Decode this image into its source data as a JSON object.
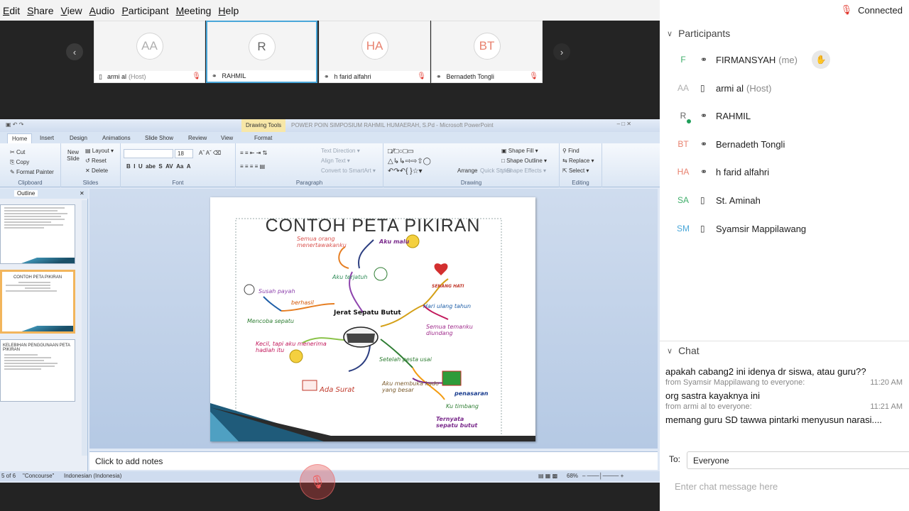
{
  "menu": [
    "Edit",
    "Share",
    "View",
    "Audio",
    "Participant",
    "Meeting",
    "Help"
  ],
  "connection": {
    "label": "Connected",
    "color": "#e0342a"
  },
  "video_tiles": [
    {
      "initials": "AA",
      "name": "armi al",
      "role": "(Host)",
      "initials_color": "#b0b0b0",
      "muted": true,
      "device": "phone"
    },
    {
      "initials": "R",
      "name": "RAHMIL",
      "role": "",
      "initials_color": "#666666",
      "muted": false,
      "device": "headset",
      "active": true
    },
    {
      "initials": "HA",
      "name": "h farid alfahri",
      "role": "",
      "initials_color": "#e8826f",
      "muted": true,
      "device": "headset"
    },
    {
      "initials": "BT",
      "name": "Bernadeth Tongli",
      "role": "",
      "initials_color": "#e8826f",
      "muted": true,
      "device": "headset"
    }
  ],
  "ppt": {
    "drawing_tools": "Drawing Tools",
    "doc_title": "POWER POIN SIMPOSIUM RAHMIL HUMAERAH, S.Pd - Microsoft PowerPoint",
    "tabs": [
      "Home",
      "Insert",
      "Design",
      "Animations",
      "Slide Show",
      "Review",
      "View",
      "Format"
    ],
    "clipboard": {
      "cut": "Cut",
      "copy": "Copy",
      "format_painter": "Format Painter",
      "label": "Clipboard"
    },
    "slides": {
      "new_slide": "New Slide",
      "layout": "Layout",
      "reset": "Reset",
      "delete": "Delete",
      "label": "Slides"
    },
    "font": {
      "size": "18",
      "label": "Font"
    },
    "paragraph": {
      "text_direction": "Text Direction",
      "align_text": "Align Text",
      "convert": "Convert to SmartArt",
      "label": "Paragraph"
    },
    "drawing": {
      "arrange": "Arrange",
      "quick_styles": "Quick Styles",
      "shape_fill": "Shape Fill",
      "shape_outline": "Shape Outline",
      "shape_effects": "Shape Effects",
      "label": "Drawing"
    },
    "editing": {
      "find": "Find",
      "replace": "Replace",
      "select": "Select",
      "label": "Editing"
    },
    "outline_tab": "Outline",
    "thumb_2_title": "CONTOH PETA PIKIRAN",
    "thumb_3_title": "KELEBIHAN PENGGUNAAN PETA PIKIRAN",
    "slide": {
      "title": "CONTOH PETA PIKIRAN",
      "center": "Jerat Sepatu Butut",
      "labels": [
        {
          "text": "Semua orang menertawakanku",
          "color": "#d9534f"
        },
        {
          "text": "Aku malu",
          "color": "#7a2b8c"
        },
        {
          "text": "Aku terjatuh",
          "color": "#2e8b57"
        },
        {
          "text": "SENANG HATI",
          "color": "#c0392b"
        },
        {
          "text": "Susah payah",
          "color": "#8e44ad"
        },
        {
          "text": "berhasil",
          "color": "#d35400"
        },
        {
          "text": "Mencoba sepatu",
          "color": "#2e7d32"
        },
        {
          "text": "Hari ulang tahun",
          "color": "#1f5fa8"
        },
        {
          "text": "Semua temanku diundang",
          "color": "#a02c8c"
        },
        {
          "text": "Kecil, tapi aku menerima hadiah itu",
          "color": "#c2185b"
        },
        {
          "text": "Setelah pesta usai",
          "color": "#2e7d32"
        },
        {
          "text": "Aku membuka kado yang besar",
          "color": "#7a5a2b"
        },
        {
          "text": "penasaran",
          "color": "#1a3d8f"
        },
        {
          "text": "Ada Surat",
          "color": "#c0392b"
        },
        {
          "text": "Ku timbang",
          "color": "#2e7d32"
        },
        {
          "text": "Ternyata sepatu butut",
          "color": "#7a2b8c"
        }
      ]
    },
    "notes_placeholder": "Click to add notes",
    "status": {
      "slide_no": "5 of 6",
      "theme": "\"Concourse\"",
      "language": "Indonesian (Indonesia)",
      "zoom": "68%"
    }
  },
  "participants": {
    "header": "Participants",
    "list": [
      {
        "initials": "F",
        "name": "FIRMANSYAH",
        "role": "(me)",
        "color": "#3fae6a",
        "device": "headset",
        "raise": true
      },
      {
        "initials": "AA",
        "name": "armi al",
        "role": "(Host)",
        "color": "#b0b0b0",
        "device": "phone"
      },
      {
        "initials": "R",
        "name": "RAHMIL",
        "role": "",
        "color": "#666666",
        "device": "headset",
        "online": true
      },
      {
        "initials": "BT",
        "name": "Bernadeth Tongli",
        "role": "",
        "color": "#e8826f",
        "device": "headset"
      },
      {
        "initials": "HA",
        "name": "h farid alfahri",
        "role": "",
        "color": "#e8826f",
        "device": "headset"
      },
      {
        "initials": "SA",
        "name": "St. Aminah",
        "role": "",
        "color": "#3fae6a",
        "device": "phone"
      },
      {
        "initials": "SM",
        "name": "Syamsir Mappilawang",
        "role": "",
        "color": "#4aa7d9",
        "device": "phone"
      }
    ]
  },
  "chat": {
    "header": "Chat",
    "messages": [
      {
        "text": "apakah cabang2 ini idenya dr siswa, atau guru??"
      },
      {
        "from": "from Syamsir Mappilawang to everyone:",
        "time": "11:20 AM",
        "text": "org sastra kayaknya ini"
      },
      {
        "from": "from armi al to everyone:",
        "time": "11:21 AM",
        "text": "memang guru SD tawwa pintarki menyusun narasi...."
      }
    ],
    "to_label": "To:",
    "to_value": "Everyone",
    "input_placeholder": "Enter chat message here"
  }
}
